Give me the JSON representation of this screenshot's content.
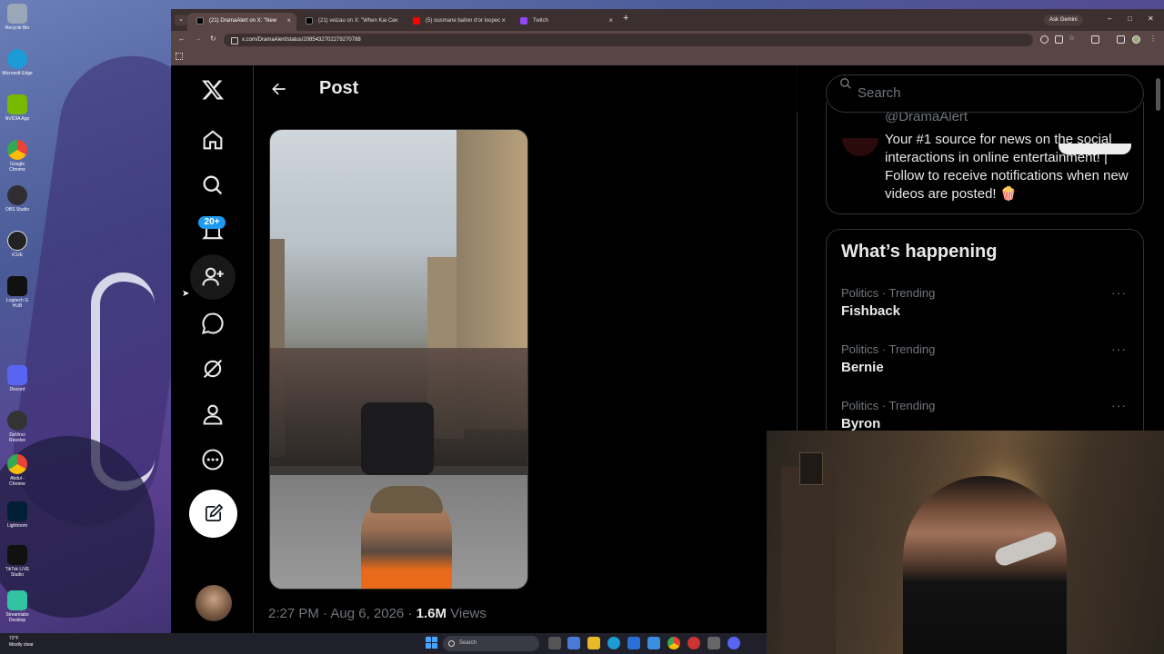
{
  "desktop": {
    "icons": [
      {
        "label": "Recycle Bin",
        "color": "#9aa7b6"
      },
      {
        "label": "Microsoft Edge",
        "color": "#1c9bd6"
      },
      {
        "label": "NVIDIA App",
        "color": "#76b900"
      },
      {
        "label": "Google Chrome",
        "color": "#ea4335"
      },
      {
        "label": "OBS Studio",
        "color": "#302e31"
      },
      {
        "label": "iCUE",
        "color": "#222"
      },
      {
        "label": "Logitech G HUB",
        "color": "#111"
      },
      {
        "label": "Discord",
        "color": "#5865f2"
      },
      {
        "label": "DaVinci Resolve",
        "color": "#333"
      },
      {
        "label": "Abdul - Chrome",
        "color": "#ea4335"
      },
      {
        "label": "Lightroom",
        "color": "#001e36"
      },
      {
        "label": "TikTok LIVE Studio",
        "color": "#111"
      },
      {
        "label": "Streamlabs Desktop",
        "color": "#31c3a2"
      }
    ]
  },
  "taskbar": {
    "weather_temp": "72°F",
    "weather_desc": "Mostly clear",
    "search_placeholder": "Search"
  },
  "browser": {
    "tabs": [
      {
        "label": "(21) DramaAlert on X: \"New",
        "active": true,
        "favicon_color": "#000"
      },
      {
        "label": "(21) veizau on X: \"When Kai Ce",
        "active": false,
        "favicon_color": "#000"
      },
      {
        "label": "(5) ousmane ballon d'or loopec",
        "active": false,
        "favicon_color": "#ff0000"
      },
      {
        "label": "Twitch",
        "active": false,
        "favicon_color": "#9146ff"
      }
    ],
    "ask_gemini": "Ask Gemini",
    "url": "x.com/DramaAlert/status/2085432702279270788"
  },
  "xnav": {
    "notification_badge": "20+",
    "items": [
      "home-icon",
      "explore-icon",
      "notifications-icon",
      "follow-icon",
      "messages-icon",
      "grok-icon",
      "profile-icon",
      "more-icon"
    ]
  },
  "main": {
    "title": "Post",
    "timestamp": "2:27 PM · Aug 6, 2026 · ",
    "views_count": "1.6M",
    "views_label": " Views"
  },
  "sidebar": {
    "search_placeholder": "Search",
    "profile_handle": "@DramaAlert",
    "profile_bio": "Your #1 source for news on the social interactions in online entertainment! | Follow to receive notifications when new videos are posted! 🍿",
    "whats_happening_title": "What’s happening",
    "trends": [
      {
        "category": "Politics · Trending",
        "name": "Fishback"
      },
      {
        "category": "Politics · Trending",
        "name": "Bernie"
      },
      {
        "category": "Politics · Trending",
        "name": "Byron"
      }
    ],
    "more_dots": "···"
  }
}
